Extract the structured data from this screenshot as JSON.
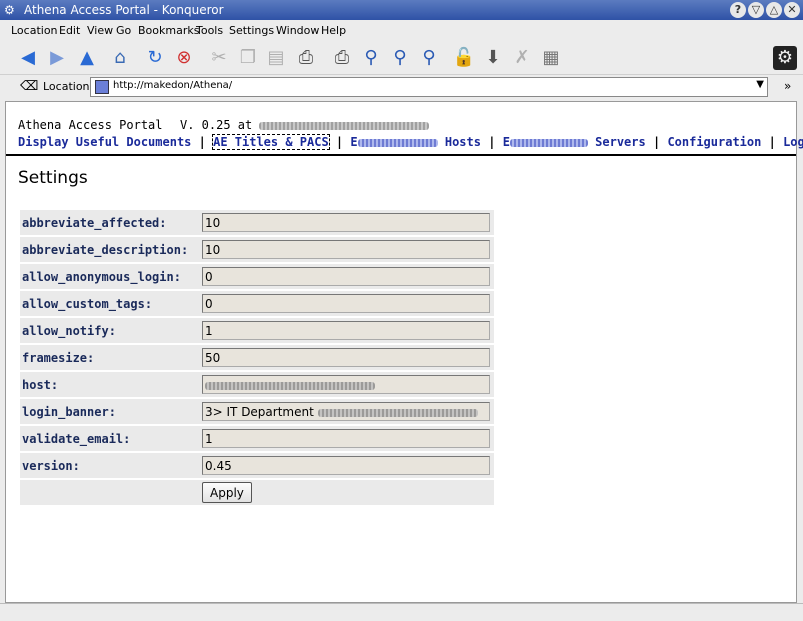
{
  "window": {
    "title": "Athena Access Portal - Konqueror",
    "buttons": [
      "?",
      "▽",
      "△",
      "✕"
    ]
  },
  "menubar": {
    "items": [
      "Location",
      "Edit",
      "View",
      "Go",
      "Bookmarks",
      "Tools",
      "Settings",
      "Window",
      "Help"
    ]
  },
  "toolbar": {
    "icons": [
      "back-icon",
      "forward-icon",
      "up-icon",
      "home-icon",
      "reload-icon",
      "stop-icon",
      "cut-icon",
      "copy-icon",
      "paste-icon",
      "print-icon",
      "print-frame-icon",
      "zoom-icon",
      "zoom-in-icon",
      "zoom-out-icon",
      "lock-icon",
      "download-icon",
      "css-off-icon",
      "frames-icon",
      "settings-gear-icon"
    ]
  },
  "location": {
    "label": "Location:",
    "url": "http://makedon/Athena/"
  },
  "header": {
    "portal_title": "Athena Access Portal",
    "version": "V. 0.25 at"
  },
  "nav": {
    "items": [
      "Display Useful Documents",
      "AE Titles & PACS",
      "E",
      "Hosts",
      "E",
      "Servers",
      "Configuration",
      "Logout"
    ]
  },
  "page": {
    "title": "Settings"
  },
  "settings": [
    {
      "name": "abbreviate_affected:",
      "value": "10"
    },
    {
      "name": "abbreviate_description:",
      "value": "10"
    },
    {
      "name": "allow_anonymous_login:",
      "value": "0"
    },
    {
      "name": "allow_custom_tags:",
      "value": "0"
    },
    {
      "name": "allow_notify:",
      "value": "1"
    },
    {
      "name": "framesize:",
      "value": "50"
    },
    {
      "name": "host:",
      "value": ""
    },
    {
      "name": "login_banner:",
      "value": "3> IT Department"
    },
    {
      "name": "validate_email:",
      "value": "1"
    },
    {
      "name": "version:",
      "value": "0.45"
    }
  ],
  "apply_label": "Apply"
}
